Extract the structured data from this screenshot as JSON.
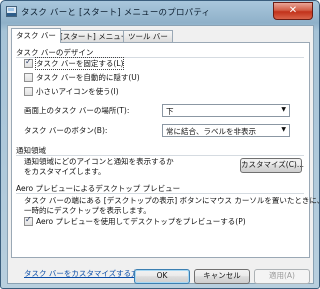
{
  "window": {
    "title": "タスク バーと [スタート] メニューのプロパティ",
    "close_label": "✕"
  },
  "tabs": [
    {
      "label": "タスク バー",
      "active": true
    },
    {
      "label": "[スタート] メニュー",
      "active": false
    },
    {
      "label": "ツール バー",
      "active": false
    }
  ],
  "appearance": {
    "heading": "タスク バーのデザイン",
    "lock": {
      "label": "タスク バーを固定する(L)",
      "checked": true
    },
    "autohide": {
      "label": "タスク バーを自動的に隠す(U)",
      "checked": false
    },
    "small_icons": {
      "label": "小さいアイコンを使う(I)",
      "checked": false
    },
    "location_label": "画面上のタスク バーの場所(T):",
    "location_value": "下",
    "buttons_label": "タスク バーのボタン(B):",
    "buttons_value": "常に結合、ラベルを非表示"
  },
  "notification": {
    "heading": "通知領域",
    "description": "通知領域にどのアイコンと通知を表示するかをカスタマイズします。",
    "customize_button": "カスタマイズ(C)..."
  },
  "aero": {
    "heading": "Aero プレビューによるデスクトップ プレビュー",
    "description_line1": "タスク バーの端にある [デスクトップの表示] ボタンにマウス カーソルを置いたときに、",
    "description_line2": "一時的にデスクトップを表示します。",
    "checkbox": {
      "label": "Aero プレビューを使用してデスクトップをプレビューする(P)",
      "checked": true
    }
  },
  "help_link": "タスク バーをカスタマイズする方法",
  "footer": {
    "ok": "OK",
    "cancel": "キャンセル",
    "apply": "適用(A)"
  },
  "colors": {
    "link": "#0a4da8",
    "close_button": "#c2321b"
  }
}
